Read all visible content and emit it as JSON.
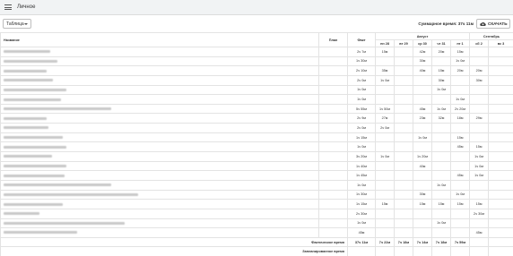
{
  "app": {
    "title": "Личное"
  },
  "toolbar": {
    "view_select": "Таблица",
    "total_time": "Суммарное время: 37ч 11м",
    "download_label": "СКАЧАТЬ"
  },
  "table": {
    "headers": {
      "name": "Название",
      "plan": "План",
      "fact": "Факт"
    },
    "months": [
      "Август",
      "Сентябрь"
    ],
    "days": [
      "пн 28",
      "вт 29",
      "ср 30",
      "чт 31",
      "пт 1",
      "сб 2",
      "вс 3"
    ],
    "rows": [
      {
        "fact": "2ч 7м",
        "d": [
          "",
          "15м",
          "",
          "42м",
          "20м",
          "15м",
          "",
          ""
        ]
      },
      {
        "fact": "1ч 30м",
        "d": [
          "",
          "",
          "",
          "30м",
          "",
          "1ч 0м",
          "",
          ""
        ]
      },
      {
        "fact": "2ч 10м",
        "d": [
          "",
          "35м",
          "",
          "40м",
          "15м",
          "20м",
          "20м",
          ""
        ]
      },
      {
        "fact": "2ч 0м",
        "d": [
          "",
          "1ч 0м",
          "",
          "",
          "30м",
          "",
          "30м",
          ""
        ]
      },
      {
        "fact": "1ч 0м",
        "d": [
          "",
          "",
          "",
          "",
          "1ч 0м",
          "",
          "",
          ""
        ]
      },
      {
        "fact": "1ч 0м",
        "d": [
          "",
          "",
          "",
          "",
          "",
          "1ч 0м",
          "",
          ""
        ]
      },
      {
        "fact": "5ч 55м",
        "d": [
          "",
          "1ч 50м",
          "",
          "45м",
          "1ч 0м",
          "2ч 20м",
          "",
          ""
        ]
      },
      {
        "fact": "2ч 9м",
        "d": [
          "",
          "27м",
          "",
          "23м",
          "32м",
          "18м",
          "29м",
          ""
        ]
      },
      {
        "fact": "2ч 0м",
        "d": [
          "",
          "2ч 0м",
          "",
          "",
          "",
          "",
          "",
          ""
        ]
      },
      {
        "fact": "1ч 15м",
        "d": [
          "",
          "",
          "",
          "1ч 0м",
          "",
          "15м",
          "",
          ""
        ]
      },
      {
        "fact": "1ч 0м",
        "d": [
          "",
          "",
          "",
          "",
          "",
          "45м",
          "15м",
          ""
        ]
      },
      {
        "fact": "3ч 20м",
        "d": [
          "",
          "1ч 0м",
          "",
          "1ч 20м",
          "",
          "",
          "1ч 0м",
          ""
        ]
      },
      {
        "fact": "1ч 40м",
        "d": [
          "",
          "",
          "",
          "40м",
          "",
          "",
          "1ч 0м",
          ""
        ]
      },
      {
        "fact": "1ч 45м",
        "d": [
          "",
          "",
          "",
          "",
          "",
          "45м",
          "1ч 0м",
          ""
        ]
      },
      {
        "fact": "1ч 0м",
        "d": [
          "",
          "",
          "",
          "",
          "1ч 0м",
          "",
          "",
          ""
        ]
      },
      {
        "fact": "1ч 30м",
        "d": [
          "",
          "",
          "",
          "30м",
          "",
          "1ч 0м",
          "",
          ""
        ]
      },
      {
        "fact": "1ч 15м",
        "d": [
          "",
          "15м",
          "",
          "15м",
          "15м",
          "15м",
          "15м",
          ""
        ]
      },
      {
        "fact": "2ч 30м",
        "d": [
          "",
          "",
          "",
          "",
          "",
          "",
          "2ч 30м",
          ""
        ]
      },
      {
        "fact": "1ч 0м",
        "d": [
          "",
          "",
          "",
          "",
          "1ч 0м",
          "",
          "",
          ""
        ]
      },
      {
        "fact": "45м",
        "d": [
          "",
          "",
          "",
          "",
          "",
          "",
          "45м",
          ""
        ]
      }
    ],
    "totals": {
      "fact_label": "Фактическое время",
      "fact_total": "37ч 11м",
      "fact_days": [
        "7ч 22м",
        "7ч 18м",
        "7ч 14м",
        "7ч 18м",
        "7ч 59м",
        "",
        ""
      ],
      "plan_label": "Запланированное время"
    }
  }
}
